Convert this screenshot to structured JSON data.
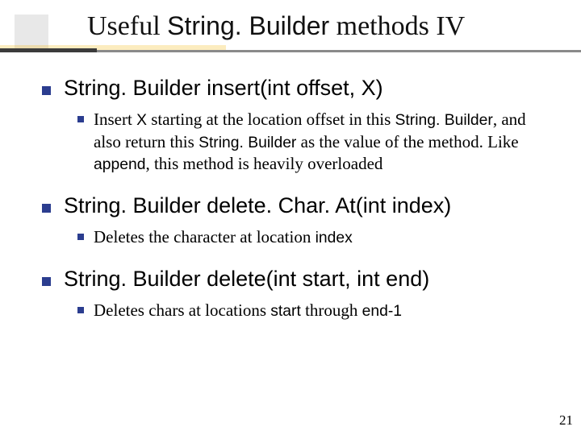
{
  "title": {
    "prefix": "Useful ",
    "code": "String. Builder",
    "suffix": " methods IV"
  },
  "items": [
    {
      "heading": "String. Builder insert(int offset, X)",
      "sub": [
        {
          "pre": "Insert ",
          "c1": "X",
          "mid1": " starting at the location offset in this ",
          "c2": "String. Builder",
          "mid2": ", and also return this ",
          "c3": "String. Builder",
          "mid3": " as the value of the method. Like ",
          "c4": "append",
          "post": ", this method is heavily overloaded"
        }
      ]
    },
    {
      "heading": "String. Builder delete. Char. At(int index)",
      "sub": [
        {
          "pre": "Deletes the character at location ",
          "c1": "index",
          "mid1": "",
          "c2": "",
          "mid2": "",
          "c3": "",
          "mid3": "",
          "c4": "",
          "post": ""
        }
      ]
    },
    {
      "heading": "String. Builder delete(int start, int end)",
      "sub": [
        {
          "pre": "Deletes chars at locations ",
          "c1": "start",
          "mid1": " through ",
          "c2": "end-1",
          "mid2": "",
          "c3": "",
          "mid3": "",
          "c4": "",
          "post": ""
        }
      ]
    }
  ],
  "page_number": "21"
}
